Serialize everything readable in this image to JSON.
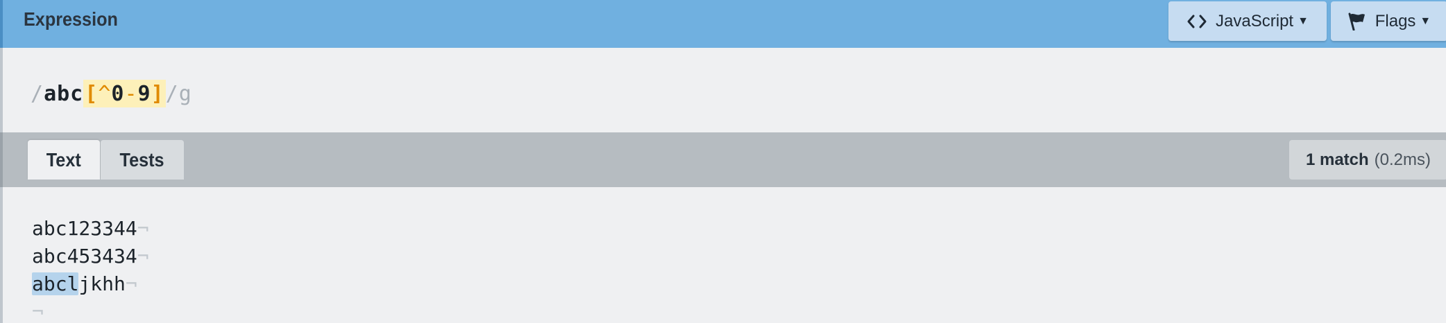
{
  "expression_panel": {
    "title": "Expression",
    "language_button": "JavaScript",
    "flags_button": "Flags",
    "expression": {
      "open_delim": "/",
      "literal": "abc",
      "set_open": "[",
      "set_negate": "^",
      "range_start": "0",
      "range_op": "-",
      "range_end": "9",
      "set_close": "]",
      "close_delim": "/",
      "flags": "g"
    }
  },
  "tabs": [
    {
      "label": "Text",
      "active": true
    },
    {
      "label": "Tests",
      "active": false
    }
  ],
  "match_status": {
    "count": "1 match",
    "time": "(0.2ms)"
  },
  "text_lines": [
    {
      "match": "",
      "rest": "abc123344"
    },
    {
      "match": "",
      "rest": "abc453434"
    },
    {
      "match": "abcl",
      "rest": "jkhh"
    },
    {
      "match": "",
      "rest": ""
    }
  ],
  "newline_marker": "¬",
  "colors": {
    "header_bg": "#70b0e0",
    "match_highlight": "#b5d3ec",
    "char_set_bg": "#fdf0b9",
    "char_set_token": "#e08a00"
  }
}
